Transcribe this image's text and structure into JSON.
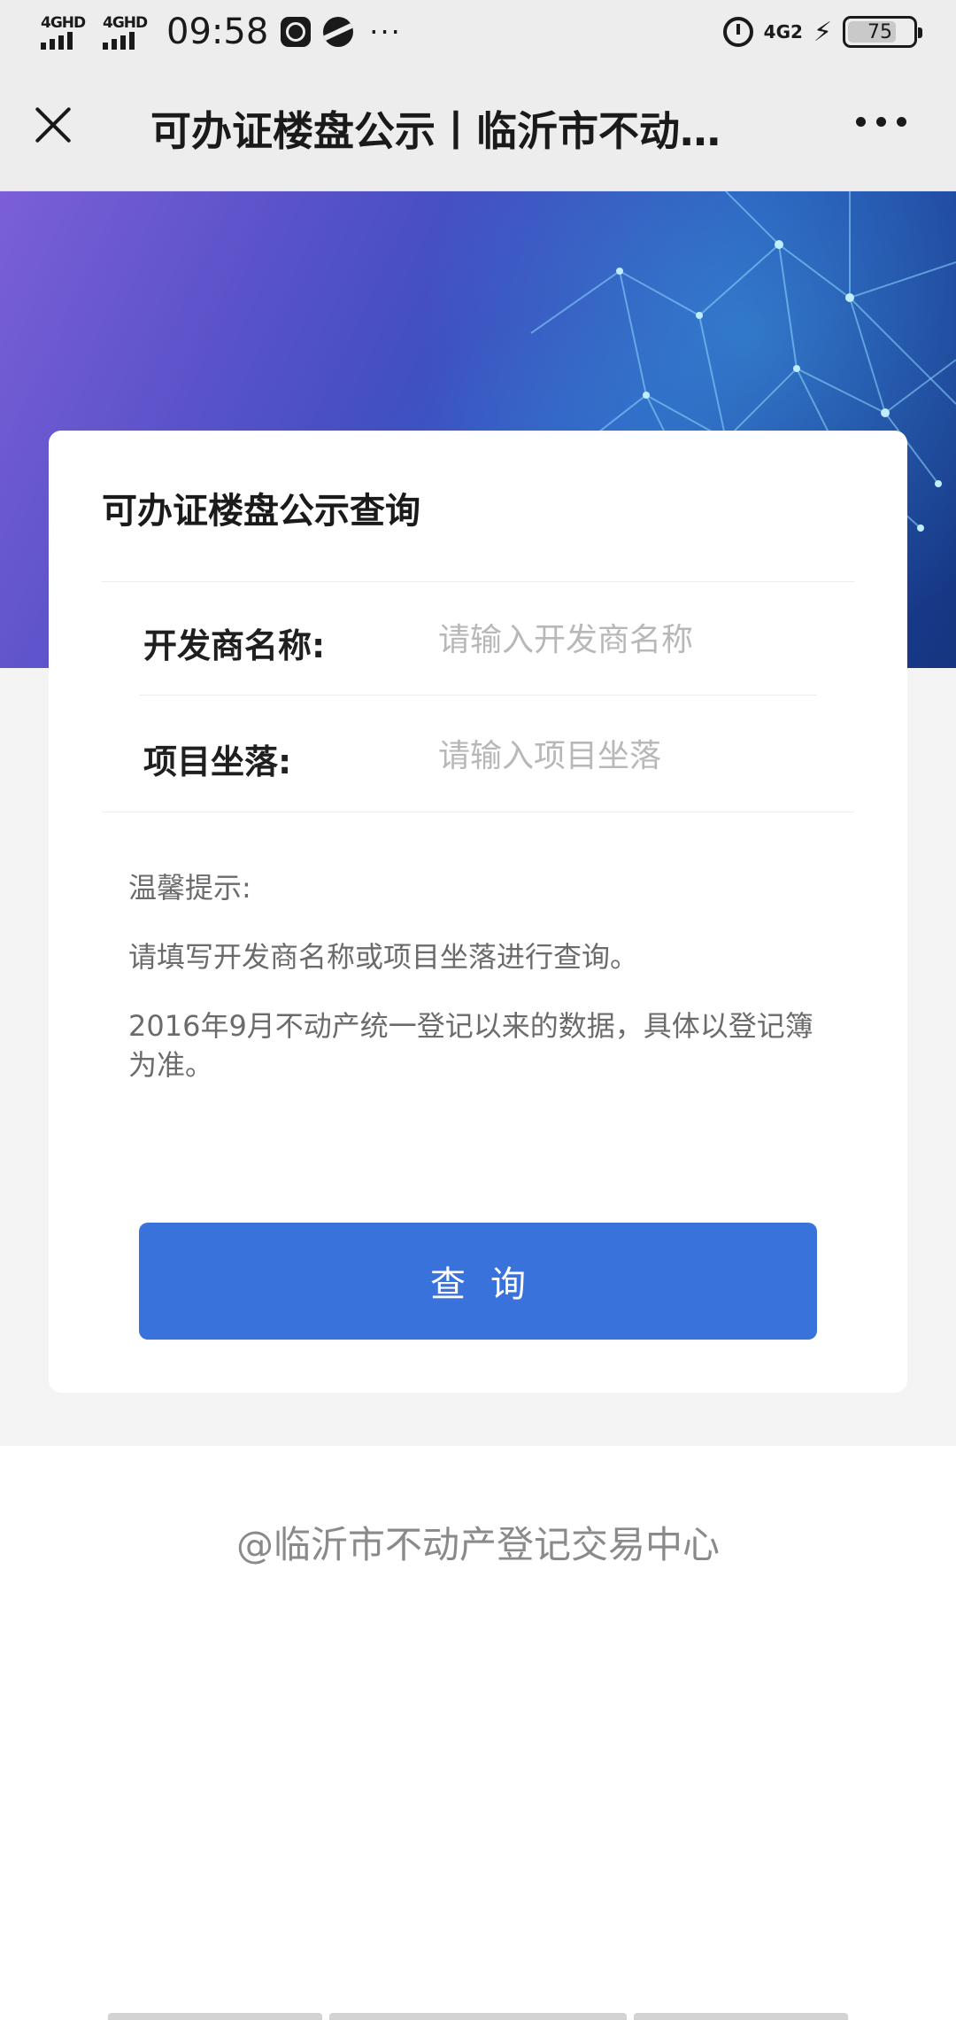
{
  "status_bar": {
    "network1": "4GHD",
    "network2": "4GHD",
    "time": "09:58",
    "more": "···",
    "network_right": "4G2",
    "battery": "75",
    "battery_level": 0.75
  },
  "title_bar": {
    "title": "可办证楼盘公示丨临沂市不动…"
  },
  "card": {
    "title": "可办证楼盘公示查询",
    "fields": [
      {
        "label": "开发商名称:",
        "placeholder": "请输入开发商名称",
        "value": ""
      },
      {
        "label": "项目坐落:",
        "placeholder": "请输入项目坐落",
        "value": ""
      }
    ],
    "tips": {
      "heading": "温馨提示:",
      "line1": "请填写开发商名称或项目坐落进行查询。",
      "line2": "2016年9月不动产统一登记以来的数据，具体以登记簿为准。"
    },
    "button": "查询"
  },
  "footer": "@临沂市不动产登记交易中心",
  "colors": {
    "accent": "#3a72dc",
    "page_bg": "#f4f4f5",
    "title_bar_bg": "#ededed"
  }
}
